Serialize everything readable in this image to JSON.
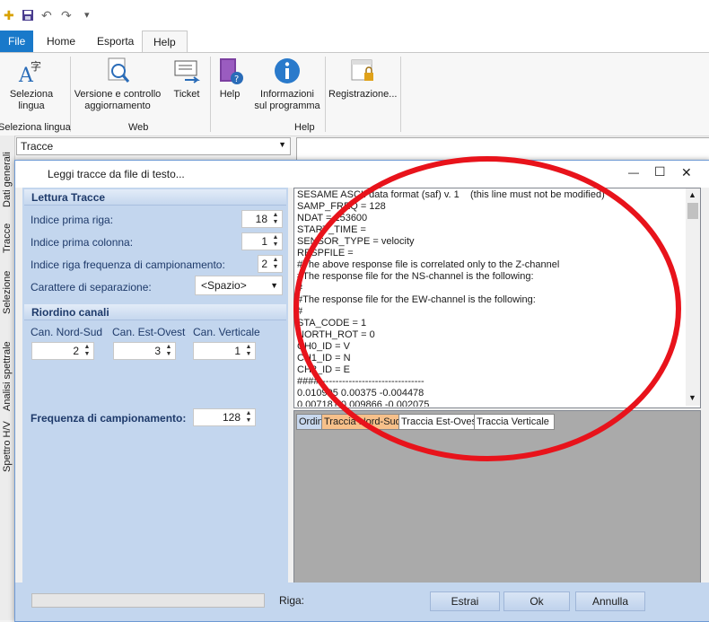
{
  "qat": {
    "undo": "↶",
    "redo": "↷",
    "more": "▾"
  },
  "tabs": [
    {
      "label": "File"
    },
    {
      "label": "Home"
    },
    {
      "label": "Esporta"
    },
    {
      "label": "Help"
    }
  ],
  "ribbon": {
    "buttons": [
      {
        "label": "Seleziona\nlingua",
        "icon": "language-icon"
      },
      {
        "label": "Versione e controllo\naggiornamento",
        "icon": "update-check-icon"
      },
      {
        "label": "Ticket",
        "icon": "ticket-icon"
      },
      {
        "label": "Help",
        "icon": "help-book-icon"
      },
      {
        "label": "Informazioni\nsul programma",
        "icon": "info-icon"
      },
      {
        "label": "Registrazione...",
        "icon": "registration-lock-icon"
      }
    ],
    "groups": [
      "Seleziona lingua",
      "Web",
      "Help"
    ]
  },
  "vtabs": [
    "Dati generali",
    "Tracce",
    "Selezione",
    "Analisi spettrale",
    "Spettro H/V"
  ],
  "background_combo": "Tracce",
  "dialog": {
    "title": "Leggi tracce da file di testo...",
    "minimize": "—",
    "maximize": "☐",
    "close": "✕",
    "section1": "Lettura Tracce",
    "fields": [
      {
        "label": "Indice prima riga:",
        "value": "18"
      },
      {
        "label": "Indice prima colonna:",
        "value": "1"
      },
      {
        "label": "Indice riga frequenza di campionamento:",
        "value": "2"
      }
    ],
    "separator_label": "Carattere di separazione:",
    "separator_value": "<Spazio>",
    "section2": "Riordino canali",
    "channels": [
      {
        "label": "Can. Nord-Sud",
        "value": "2"
      },
      {
        "label": "Can. Est-Ovest",
        "value": "3"
      },
      {
        "label": "Can. Verticale",
        "value": "1"
      }
    ],
    "freq_label": "Frequenza di campionamento:",
    "freq_value": "128",
    "text_lines": [
      "SESAME ASCII data format (saf) v. 1    (this line must not be modified)",
      "SAMP_FREQ = 128",
      "NDAT = 153600",
      "START_TIME =",
      "SENSOR_TYPE = velocity",
      "RESPFILE =",
      "#The above response file is correlated only to the Z-channel",
      "#The response file for the NS-channel is the following:",
      "#",
      "#The response file for the EW-channel is the following:",
      "#",
      "STA_CODE = 1",
      "NORTH_ROT = 0",
      "CH0_ID = V",
      "CH1_ID = N",
      "CH2_ID = E",
      "####--------------------------------",
      "0.010995 0.00375 -0.004478",
      "0.007181 0.009866 -0.002075"
    ],
    "grid_tabs": [
      "Ordin",
      "Traccia Nord-Sud",
      "Traccia Est-Ovest",
      "Traccia Verticale"
    ],
    "riga_label": "Riga:",
    "buttons": {
      "estrai": "Estrai",
      "ok": "Ok",
      "annulla": "Annulla"
    }
  },
  "colors": {
    "file_tab": "#1979ca",
    "panel": "#c3d6ee",
    "ellipse": "#e8131b",
    "active_grid_tab": "#f7c08a"
  }
}
